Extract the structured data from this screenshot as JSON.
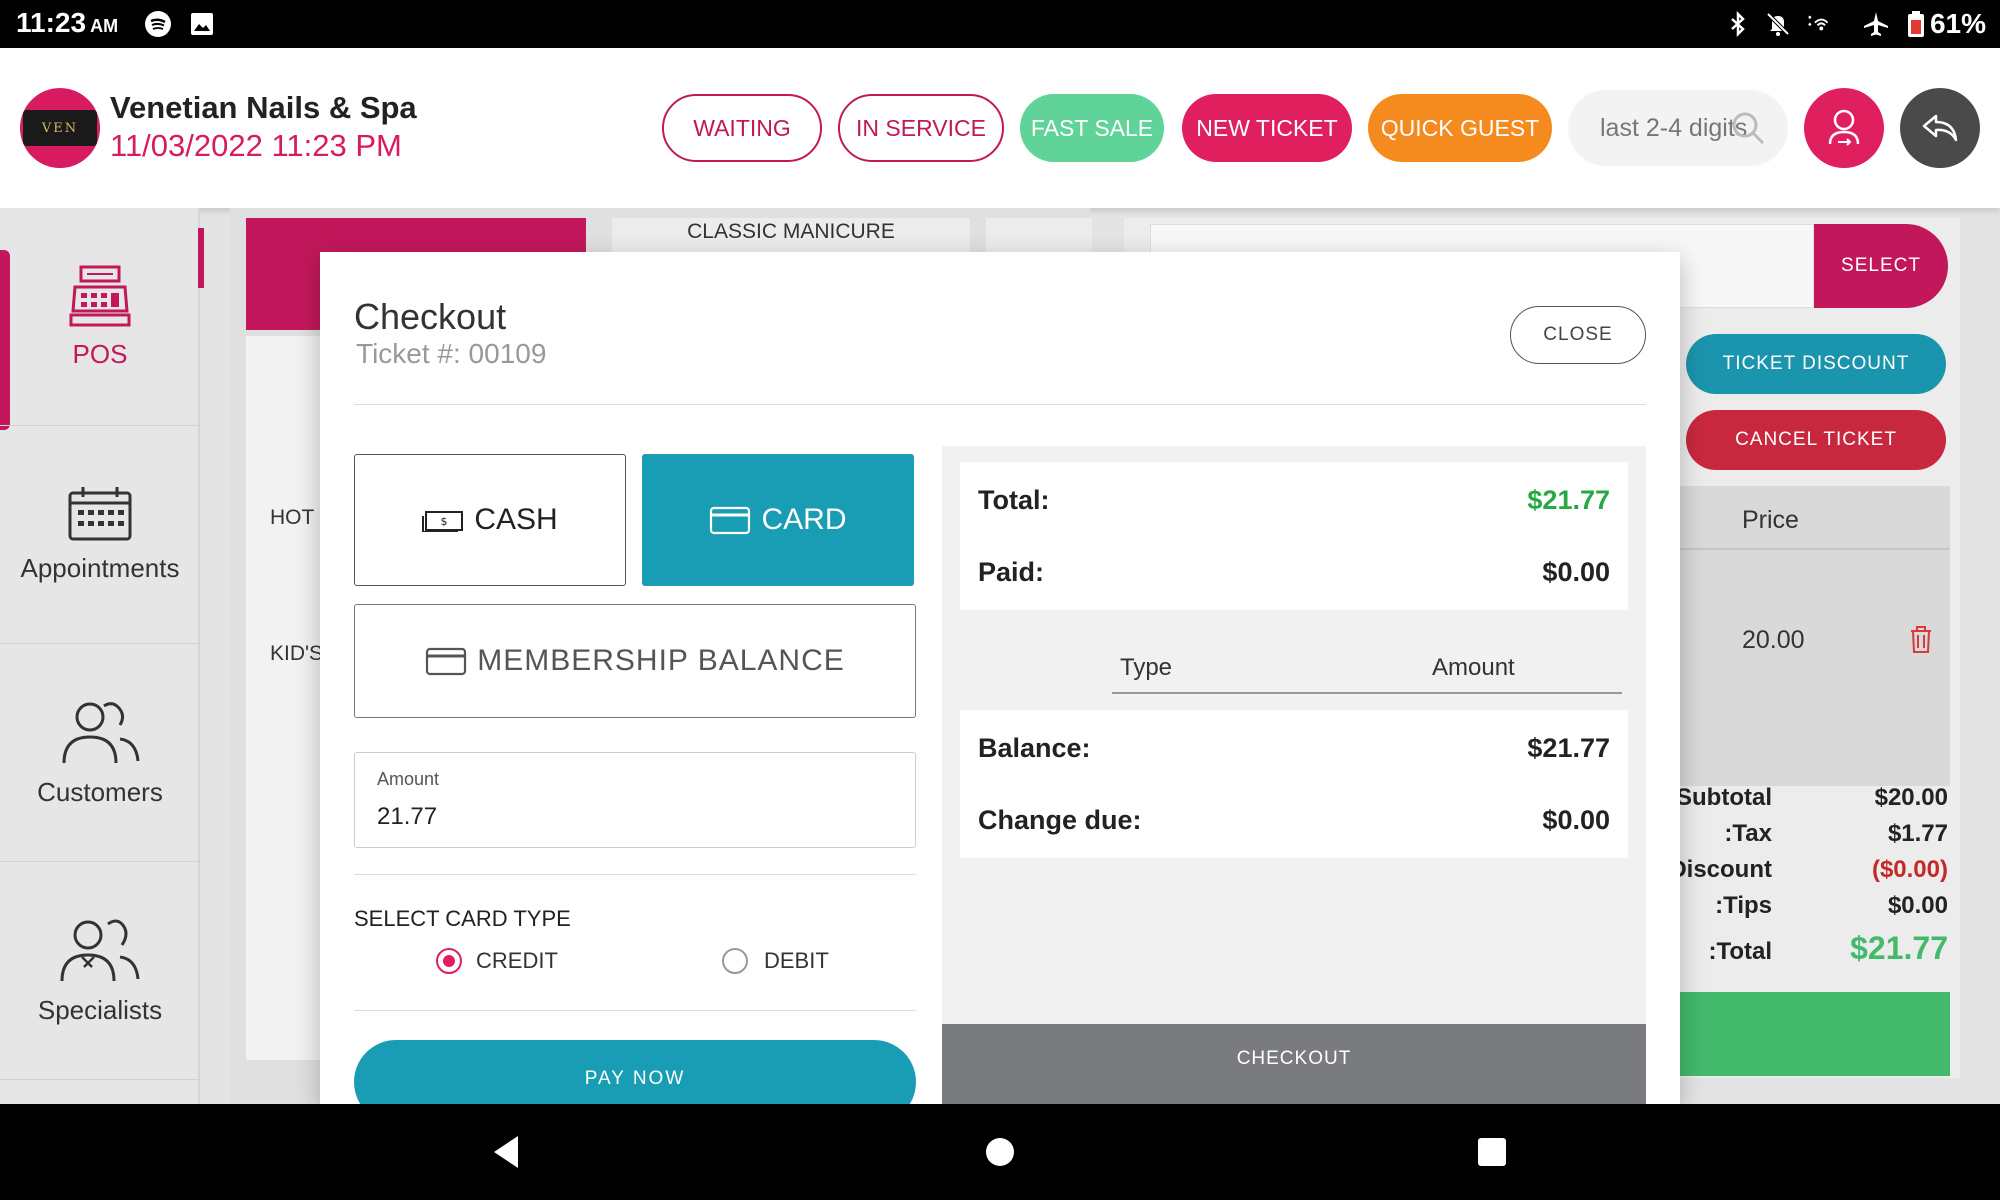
{
  "status_bar": {
    "time": "11:23",
    "ampm": "AM",
    "battery": "61%"
  },
  "header": {
    "salon_name": "Venetian Nails & Spa",
    "datetime": "11/03/2022 11:23 PM",
    "logo_text": "VEN",
    "buttons": {
      "waiting": "WAITING",
      "in_service": "IN SERVICE",
      "fast_sale": "FAST SALE",
      "new_ticket": "NEW TICKET",
      "quick_guest": "QUICK GUEST"
    },
    "search_placeholder": "last 2-4 digits"
  },
  "sidebar": {
    "items": [
      {
        "label": "POS",
        "icon": "cash-register-icon",
        "active": true
      },
      {
        "label": "Appointments",
        "icon": "calendar-icon",
        "active": false
      },
      {
        "label": "Customers",
        "icon": "customers-icon",
        "active": false
      },
      {
        "label": "Specialists",
        "icon": "specialists-icon",
        "active": false
      }
    ]
  },
  "background": {
    "service_tile": "CLASSIC MANICURE",
    "list_labels": [
      "HOT",
      "KID'S"
    ],
    "select_label": "SELECT",
    "ticket_discount": "TICKET DISCOUNT",
    "cancel_ticket": "CANCEL TICKET",
    "price_header": "Price",
    "row_price": "20.00",
    "summary": {
      "subtotal_label": "Subtotal:",
      "subtotal": "$20.00",
      "tax_label": "Tax:",
      "tax": "$1.77",
      "discount_label": "Discount:",
      "discount": "($0.00)",
      "tips_label": "Tips:",
      "tips": "$0.00",
      "total_label": "Total:",
      "total": "$21.77"
    }
  },
  "modal": {
    "title": "Checkout",
    "ticket": "Ticket #: 00109",
    "close_label": "CLOSE",
    "payment_methods": {
      "cash": "CASH",
      "card": "CARD",
      "membership": "MEMBERSHIP BALANCE"
    },
    "selected_method": "CARD",
    "amount_label": "Amount",
    "amount_value": "21.77",
    "card_type_label": "SELECT CARD TYPE",
    "card_types": {
      "credit": "CREDIT",
      "debit": "DEBIT"
    },
    "selected_card_type": "CREDIT",
    "pay_now_label": "PAY NOW",
    "summary": {
      "total_label": "Total:",
      "total": "$21.77",
      "paid_label": "Paid:",
      "paid": "$0.00",
      "type_header": "Type",
      "amount_header": "Amount",
      "balance_label": "Balance:",
      "balance": "$21.77",
      "change_label": "Change due:",
      "change": "$0.00"
    },
    "checkout_label": "CHECKOUT"
  },
  "colors": {
    "brand_pink": "#c2185b",
    "accent_teal": "#199db5",
    "success_green": "#27a844",
    "warning_orange": "#f58a1f",
    "fast_sale_green": "#5fd398"
  }
}
